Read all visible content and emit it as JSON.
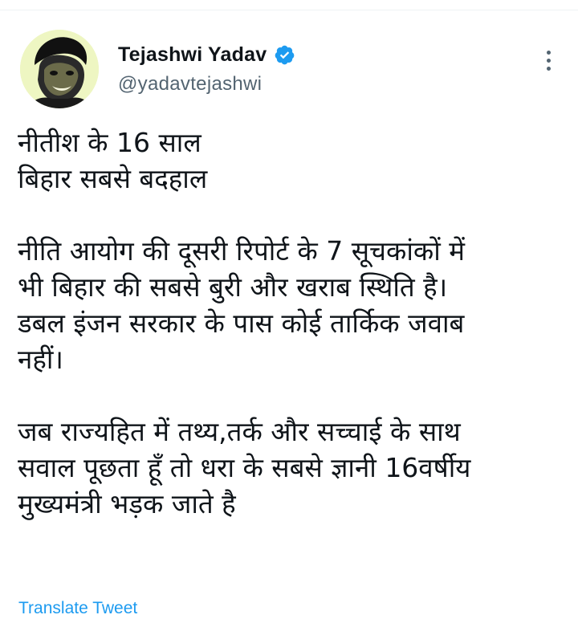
{
  "author": {
    "display_name": "Tejashwi Yadav",
    "handle": "@yadavtejashwi",
    "verified": true,
    "avatar_icon": "profile-photo"
  },
  "tweet": {
    "lines": [
      "नीतीश के 16 साल",
      "बिहार सबसे बदहाल",
      "",
      "नीति आयोग की दूसरी रिपोर्ट के 7 सूचकांकों में",
      "भी बिहार की सबसे बुरी और खराब स्थिति है।",
      "डबल इंजन सरकार के पास कोई तार्किक जवाब",
      "नहीं।",
      "",
      "जब राज्यहित में तथ्य,तर्क और सच्चाई के साथ",
      "सवाल पूछता हूँ तो धरा के सबसे ज्ञानी 16वर्षीय",
      "मुख्यमंत्री भड़क जाते है"
    ],
    "translate_label": "Translate Tweet"
  },
  "colors": {
    "accent": "#1d9bf0",
    "text": "#0f1419",
    "secondary": "#536471"
  },
  "icons": {
    "verified": "verified-badge-icon",
    "more": "more-options-icon"
  }
}
